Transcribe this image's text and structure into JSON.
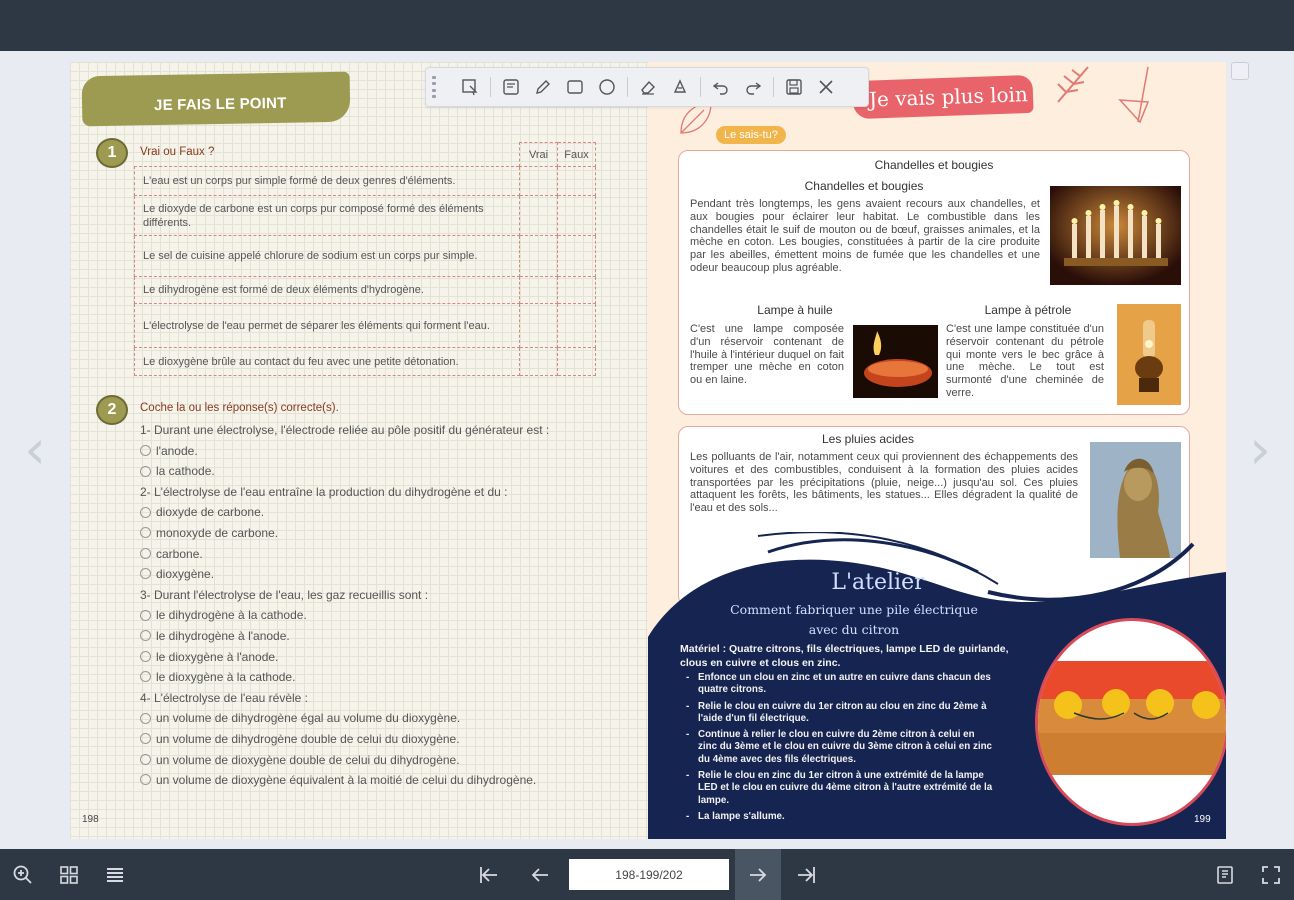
{
  "viewer": {
    "page_indicator": "198-199/202",
    "left_page_number": "198",
    "right_page_number": "199"
  },
  "toolbar_icons": [
    "grip-icon",
    "select-icon",
    "note-icon",
    "pen-icon",
    "rectangle-icon",
    "circle-icon",
    "eraser-icon",
    "clear-icon",
    "undo-icon",
    "redo-icon",
    "save-icon",
    "close-icon"
  ],
  "left_page": {
    "banner": "JE FAIS LE POINT",
    "q1": {
      "number": "1",
      "title": "Vrai ou Faux ?",
      "col_true": "Vrai",
      "col_false": "Faux",
      "statements": [
        "L'eau est un corps pur simple formé de deux genres d'éléments.",
        "Le dioxyde de carbone est un corps pur composé formé des éléments différents.",
        "Le sel de cuisine appelé chlorure de sodium est un corps pur simple.",
        "Le dihydrogène est formé de deux éléments d'hydrogène.",
        "L'électrolyse de l'eau permet de séparer les éléments qui forment l'eau.",
        "Le dioxygène brûle au contact du feu avec une petite détonation."
      ]
    },
    "q2": {
      "number": "2",
      "title": "Coche la ou les réponse(s) correcte(s).",
      "items": [
        {
          "prompt": "1- Durant une électrolyse, l'électrode reliée au pôle positif du générateur est :",
          "options": [
            "l'anode.",
            "la cathode."
          ]
        },
        {
          "prompt": "2- L'électrolyse de l'eau entraîne la production du dihydrogène et du :",
          "options": [
            "dioxyde de carbone.",
            "monoxyde de carbone.",
            "carbone.",
            "dioxygène."
          ]
        },
        {
          "prompt": "3- Durant l'électrolyse de l'eau, les gaz recueillis sont :",
          "options": [
            "le dihydrogène à la cathode.",
            "le dihydrogène à l'anode.",
            "le dioxygène à l'anode.",
            "le dioxygène à la cathode."
          ]
        },
        {
          "prompt": "4- L'électrolyse de l'eau révèle :",
          "options": [
            "un volume de dihydrogène égal au volume du dioxygène.",
            "un volume de dihydrogène double de celui du dioxygène.",
            "un volume de dioxygène double de celui du dihydrogène.",
            "un volume de dioxygène équivalent à la moitié de celui du dihydrogène."
          ]
        }
      ]
    }
  },
  "right_page": {
    "banner": "Je vais plus loin",
    "tag": "Le sais-tu?",
    "card1": {
      "heading": "Chandelles et bougies",
      "subheading": "Chandelles et bougies",
      "text": "Pendant très longtemps, les gens avaient recours aux chandelles, et aux bougies pour éclairer leur habitat. Le combustible dans les chandelles était le suif de mouton ou de bœuf, graisses animales, et la mèche en coton. Les bougies, constituées à partir de la cire produite par les abeilles, émettent moins de fumée que les chandelles et une odeur beaucoup plus agréable.",
      "lamp_oil_title": "Lampe à huile",
      "lamp_oil_text": "C'est une lampe composée d'un réservoir contenant de l'huile à l'intérieur duquel on fait tremper une mèche en coton ou en laine.",
      "lamp_petrol_title": "Lampe à pétrole",
      "lamp_petrol_text": "C'est une lampe constituée d'un réservoir contenant du pétrole qui monte vers le bec grâce à une mèche. Le tout est surmonté d'une cheminée de verre."
    },
    "card2": {
      "heading": "Les pluies acides",
      "text": "Les polluants de l'air, notamment ceux qui proviennent des échappements des voitures et des combustibles, conduisent à la formation des pluies acides transportées par les précipitations (pluie, neige...) jusqu'au sol. Ces pluies attaquent les forêts, les bâtiments, les statues... Elles dégradent la qualité de l'eau et des sols..."
    },
    "atelier": {
      "title": "L'atelier",
      "subtitle_1": "Comment fabriquer une pile électrique",
      "subtitle_2": "avec du citron",
      "materiel": "Matériel : Quatre citrons, fils électriques, lampe LED de guirlande, clous en cuivre et clous en zinc.",
      "steps": [
        "Enfonce un clou en zinc et un autre en cuivre dans chacun des quatre citrons.",
        "Relie le clou en cuivre du 1er citron au clou en zinc du 2ème à l'aide d'un fil électrique.",
        "Continue à relier le clou en cuivre du 2ème citron à celui en zinc du 3ème et le clou en cuivre du 3ème citron à celui en zinc du 4ème avec des fils électriques.",
        "Relie le clou en zinc du 1er citron à une extrémité de la lampe LED et le clou en cuivre du 4ème citron à l'autre extrémité de la lampe.",
        "La lampe s'allume."
      ]
    }
  }
}
